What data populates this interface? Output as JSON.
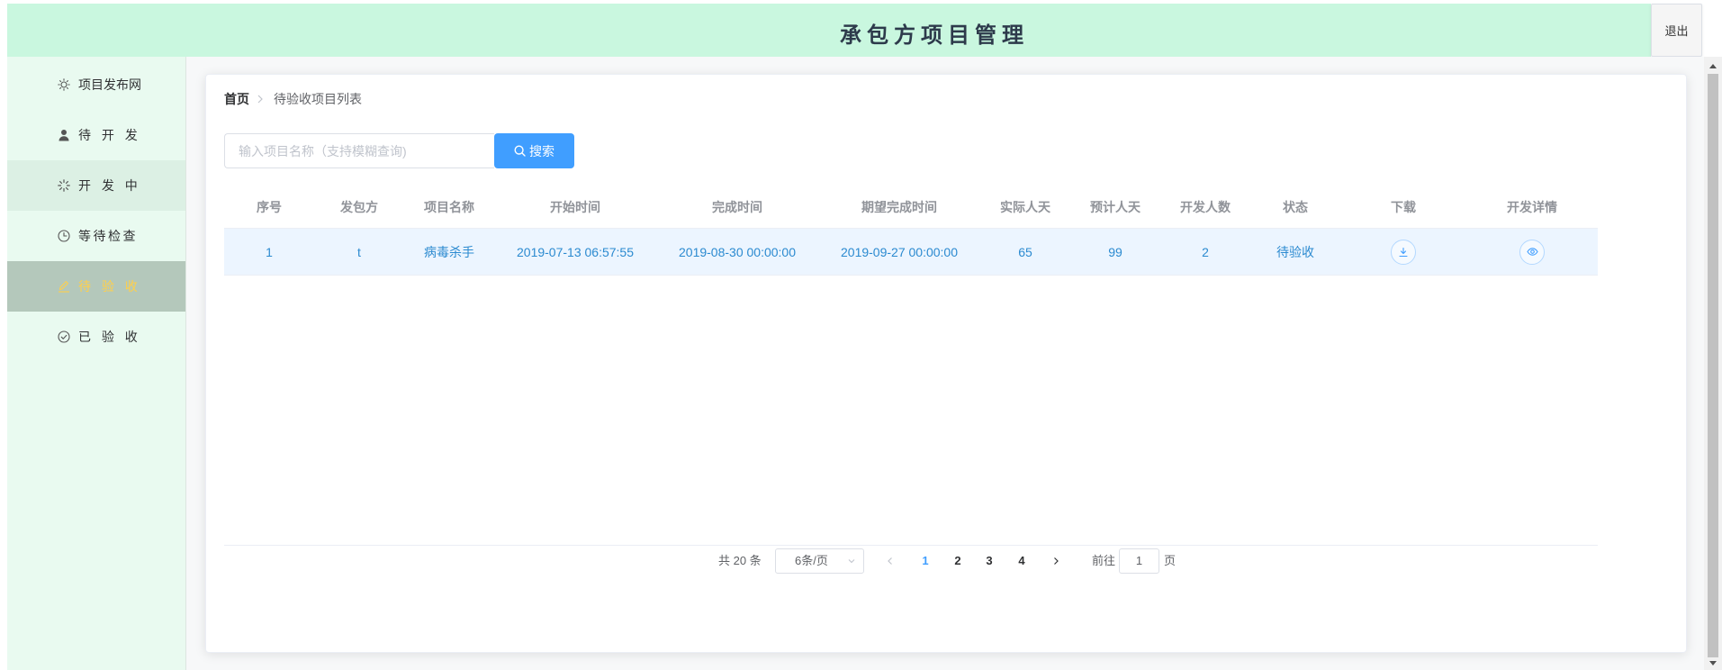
{
  "header": {
    "title": "承包方项目管理",
    "logout_label": "退出"
  },
  "sidebar": {
    "items": [
      {
        "label": "项目发布网",
        "icon": "sun-icon"
      },
      {
        "label": "待 开 发",
        "icon": "user-icon"
      },
      {
        "label": "开 发 中",
        "icon": "loading-icon"
      },
      {
        "label": "等待检查",
        "icon": "clock-icon"
      },
      {
        "label": "待 验 收",
        "icon": "edit-icon",
        "active": true
      },
      {
        "label": "已 验 收",
        "icon": "circle-check-icon"
      }
    ]
  },
  "breadcrumb": {
    "home": "首页",
    "current": "待验收项目列表"
  },
  "search": {
    "placeholder": "输入项目名称（支持模糊查询)",
    "button_label": "搜索",
    "icon": "search-icon"
  },
  "table": {
    "columns": [
      "序号",
      "发包方",
      "项目名称",
      "开始时间",
      "完成时间",
      "期望完成时间",
      "实际人天",
      "预计人天",
      "开发人数",
      "状态",
      "下载",
      "开发详情"
    ],
    "rows": [
      {
        "index": "1",
        "publisher": "t",
        "project_name": "病毒杀手",
        "start_time": "2019-07-13 06:57:55",
        "finish_time": "2019-08-30 00:00:00",
        "expected_finish_time": "2019-09-27 00:00:00",
        "actual_person_days": "65",
        "estimated_person_days": "99",
        "developer_count": "2",
        "status": "待验收",
        "download_icon": "download-icon",
        "detail_icon": "eye-icon"
      }
    ]
  },
  "pagination": {
    "total_text": "共 20 条",
    "page_size": "6条/页",
    "pages": [
      {
        "label": "1",
        "active": true
      },
      {
        "label": "2"
      },
      {
        "label": "3"
      },
      {
        "label": "4"
      }
    ],
    "goto_label": "前往",
    "goto_value": "1",
    "page_suffix": "页"
  },
  "colors": {
    "header_bg": "#c9f7df",
    "sidebar_bg": "#e9faf0",
    "active_bg": "#b4c8bb",
    "active_text": "#ffd04b",
    "primary": "#409eff",
    "row_text": "#2b8ad0"
  }
}
